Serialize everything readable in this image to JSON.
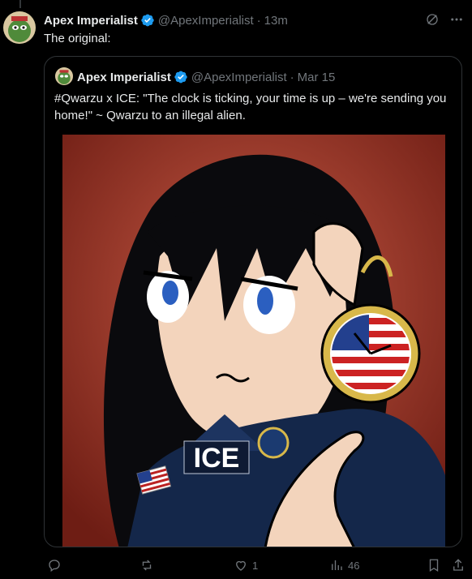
{
  "post": {
    "author_name": "Apex Imperialist",
    "author_handle": "@ApexImperialist",
    "separator": "·",
    "time": "13m",
    "text": "The original:"
  },
  "quoted": {
    "author_name": "Apex Imperialist",
    "author_handle": "@ApexImperialist",
    "separator": "·",
    "date": "Mar 15",
    "text": "#Qwarzu x ICE: \"The clock is ticking, your time is up – we're sending you home!\" ~ Qwarzu to an illegal alien.",
    "image_text": "ICE"
  },
  "actions": {
    "reply_count": "",
    "repost_count": "",
    "like_count": "1",
    "views_count": "46"
  },
  "colors": {
    "accent": "#1d9bf0",
    "muted": "#71767b",
    "border": "#2f3336"
  }
}
